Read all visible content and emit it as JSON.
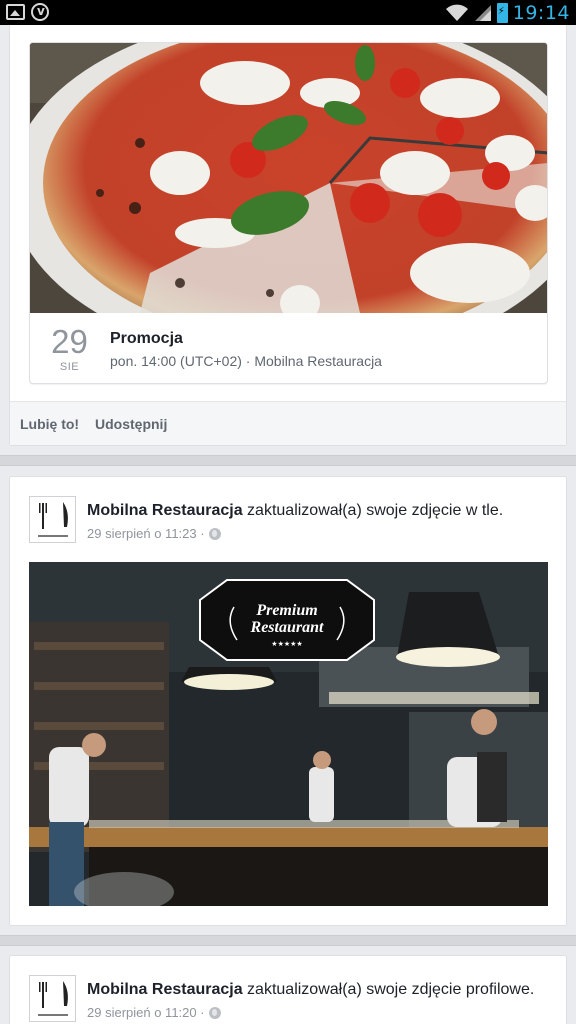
{
  "status_bar": {
    "time": "19:14",
    "left_icons": [
      "picture-icon",
      "shield-icon"
    ],
    "right_icons": [
      "wifi-icon",
      "signal-icon",
      "battery-charging-icon"
    ],
    "accent_color": "#33b5e5"
  },
  "event": {
    "day": "29",
    "month": "SIE",
    "title": "Promocja",
    "subtitle": "pon. 14:00 (UTC+02) · Mobilna Restauracja",
    "actions": {
      "like": "Lubię to!",
      "share": "Udostępnij"
    }
  },
  "posts": [
    {
      "author": "Mobilna Restauracja",
      "action_text": " zaktualizował(a) swoje zdjęcie w tle.",
      "timestamp": "29 sierpień o 11:23 ·",
      "image": {
        "logo_line1": "Premium",
        "logo_line2": "Restaurant",
        "logo_stars": "★★★★★"
      }
    },
    {
      "author": "Mobilna Restauracja",
      "action_text": " zaktualizował(a) swoje zdjęcie profilowe.",
      "timestamp": "29 sierpień o 11:20 ·"
    }
  ]
}
